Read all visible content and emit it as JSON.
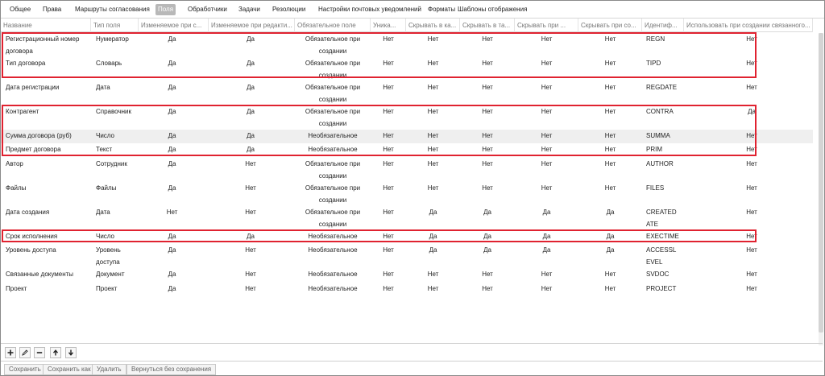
{
  "tabs": [
    {
      "label": "Общее",
      "active": false
    },
    {
      "label": "Права",
      "active": false
    },
    {
      "label": "Маршруты согласования",
      "active": false
    },
    {
      "label": "Поля",
      "active": true
    },
    {
      "label": "Обработчики",
      "active": false
    },
    {
      "label": "Задачи",
      "active": false
    },
    {
      "label": "Резолюции",
      "active": false
    },
    {
      "label": "Настройки почтовых уведомлений",
      "active": false
    },
    {
      "label": "Форматы",
      "active": false
    },
    {
      "label": "Шаблоны отображения",
      "active": false
    }
  ],
  "table": {
    "headers": [
      "Название",
      "Тип поля",
      "Изменяемое при с...",
      "Изменяемое при редакти...",
      "Обязательное поле",
      "Уника...",
      "Скрывать в ка...",
      "Скрывать в та...",
      "Скрывать при ...",
      "Скрывать при со...",
      "Идентиф...",
      "Использовать при создании связанного..."
    ],
    "rows": [
      [
        "Регистрационный номер договора",
        "Нумератор",
        "Да",
        "Да",
        "Обязательное при создании",
        "Нет",
        "Нет",
        "Нет",
        "Нет",
        "Нет",
        "REGN",
        "Нет"
      ],
      [
        "Тип договора",
        "Словарь",
        "Да",
        "Да",
        "Обязательное при создании",
        "Нет",
        "Нет",
        "Нет",
        "Нет",
        "Нет",
        "TIPD",
        "Нет"
      ],
      [
        "Дата регистрации",
        "Дата",
        "Да",
        "Да",
        "Обязательное при создании",
        "Нет",
        "Нет",
        "Нет",
        "Нет",
        "Нет",
        "REGDATE",
        "Нет"
      ],
      [
        "Контрагент",
        "Справочник",
        "Да",
        "Да",
        "Обязательное при создании",
        "Нет",
        "Нет",
        "Нет",
        "Нет",
        "Нет",
        "CONTRA",
        "Да"
      ],
      [
        "Сумма договора (руб)",
        "Число",
        "Да",
        "Да",
        "Необязательное",
        "Нет",
        "Нет",
        "Нет",
        "Нет",
        "Нет",
        "SUMMA",
        "Нет"
      ],
      [
        "Предмет договора",
        "Текст",
        "Да",
        "Да",
        "Необязательное",
        "Нет",
        "Нет",
        "Нет",
        "Нет",
        "Нет",
        "PRIM",
        "Нет"
      ],
      [
        "Автор",
        "Сотрудник",
        "Да",
        "Нет",
        "Обязательное при создании",
        "Нет",
        "Нет",
        "Нет",
        "Нет",
        "Нет",
        "AUTHOR",
        "Нет"
      ],
      [
        "Файлы",
        "Файлы",
        "Да",
        "Нет",
        "Обязательное при создании",
        "Нет",
        "Нет",
        "Нет",
        "Нет",
        "Нет",
        "FILES",
        "Нет"
      ],
      [
        "Дата создания",
        "Дата",
        "Нет",
        "Нет",
        "Обязательное при создании",
        "Нет",
        "Да",
        "Да",
        "Да",
        "Да",
        "CREATEDATE",
        "Нет"
      ],
      [
        "Срок исполнения",
        "Число",
        "Да",
        "Да",
        "Необязательное",
        "Нет",
        "Да",
        "Да",
        "Да",
        "Да",
        "EXECTIME",
        "Нет"
      ],
      [
        "Уровень доступа",
        "Уровень доступа",
        "Да",
        "Нет",
        "Необязательное",
        "Нет",
        "Да",
        "Да",
        "Да",
        "Да",
        "ACCESSLEVEL",
        "Нет"
      ],
      [
        "Связанные документы",
        "Документ",
        "Да",
        "Нет",
        "Необязательное",
        "Нет",
        "Нет",
        "Нет",
        "Нет",
        "Нет",
        "SVDOC",
        "Нет"
      ],
      [
        "Проект",
        "Проект",
        "Да",
        "Нет",
        "Необязательное",
        "Нет",
        "Нет",
        "Нет",
        "Нет",
        "Нет",
        "PROJECT",
        "Нет"
      ]
    ],
    "highlighted_row": 4
  },
  "toolbar": {
    "icons": [
      "add-icon",
      "edit-icon",
      "remove-icon",
      "move-up-icon",
      "move-down-icon"
    ]
  },
  "actions": {
    "save": "Сохранить",
    "save_as": "Сохранить как",
    "delete": "Удалить",
    "back_without_saving": "Вернуться без сохранения"
  }
}
